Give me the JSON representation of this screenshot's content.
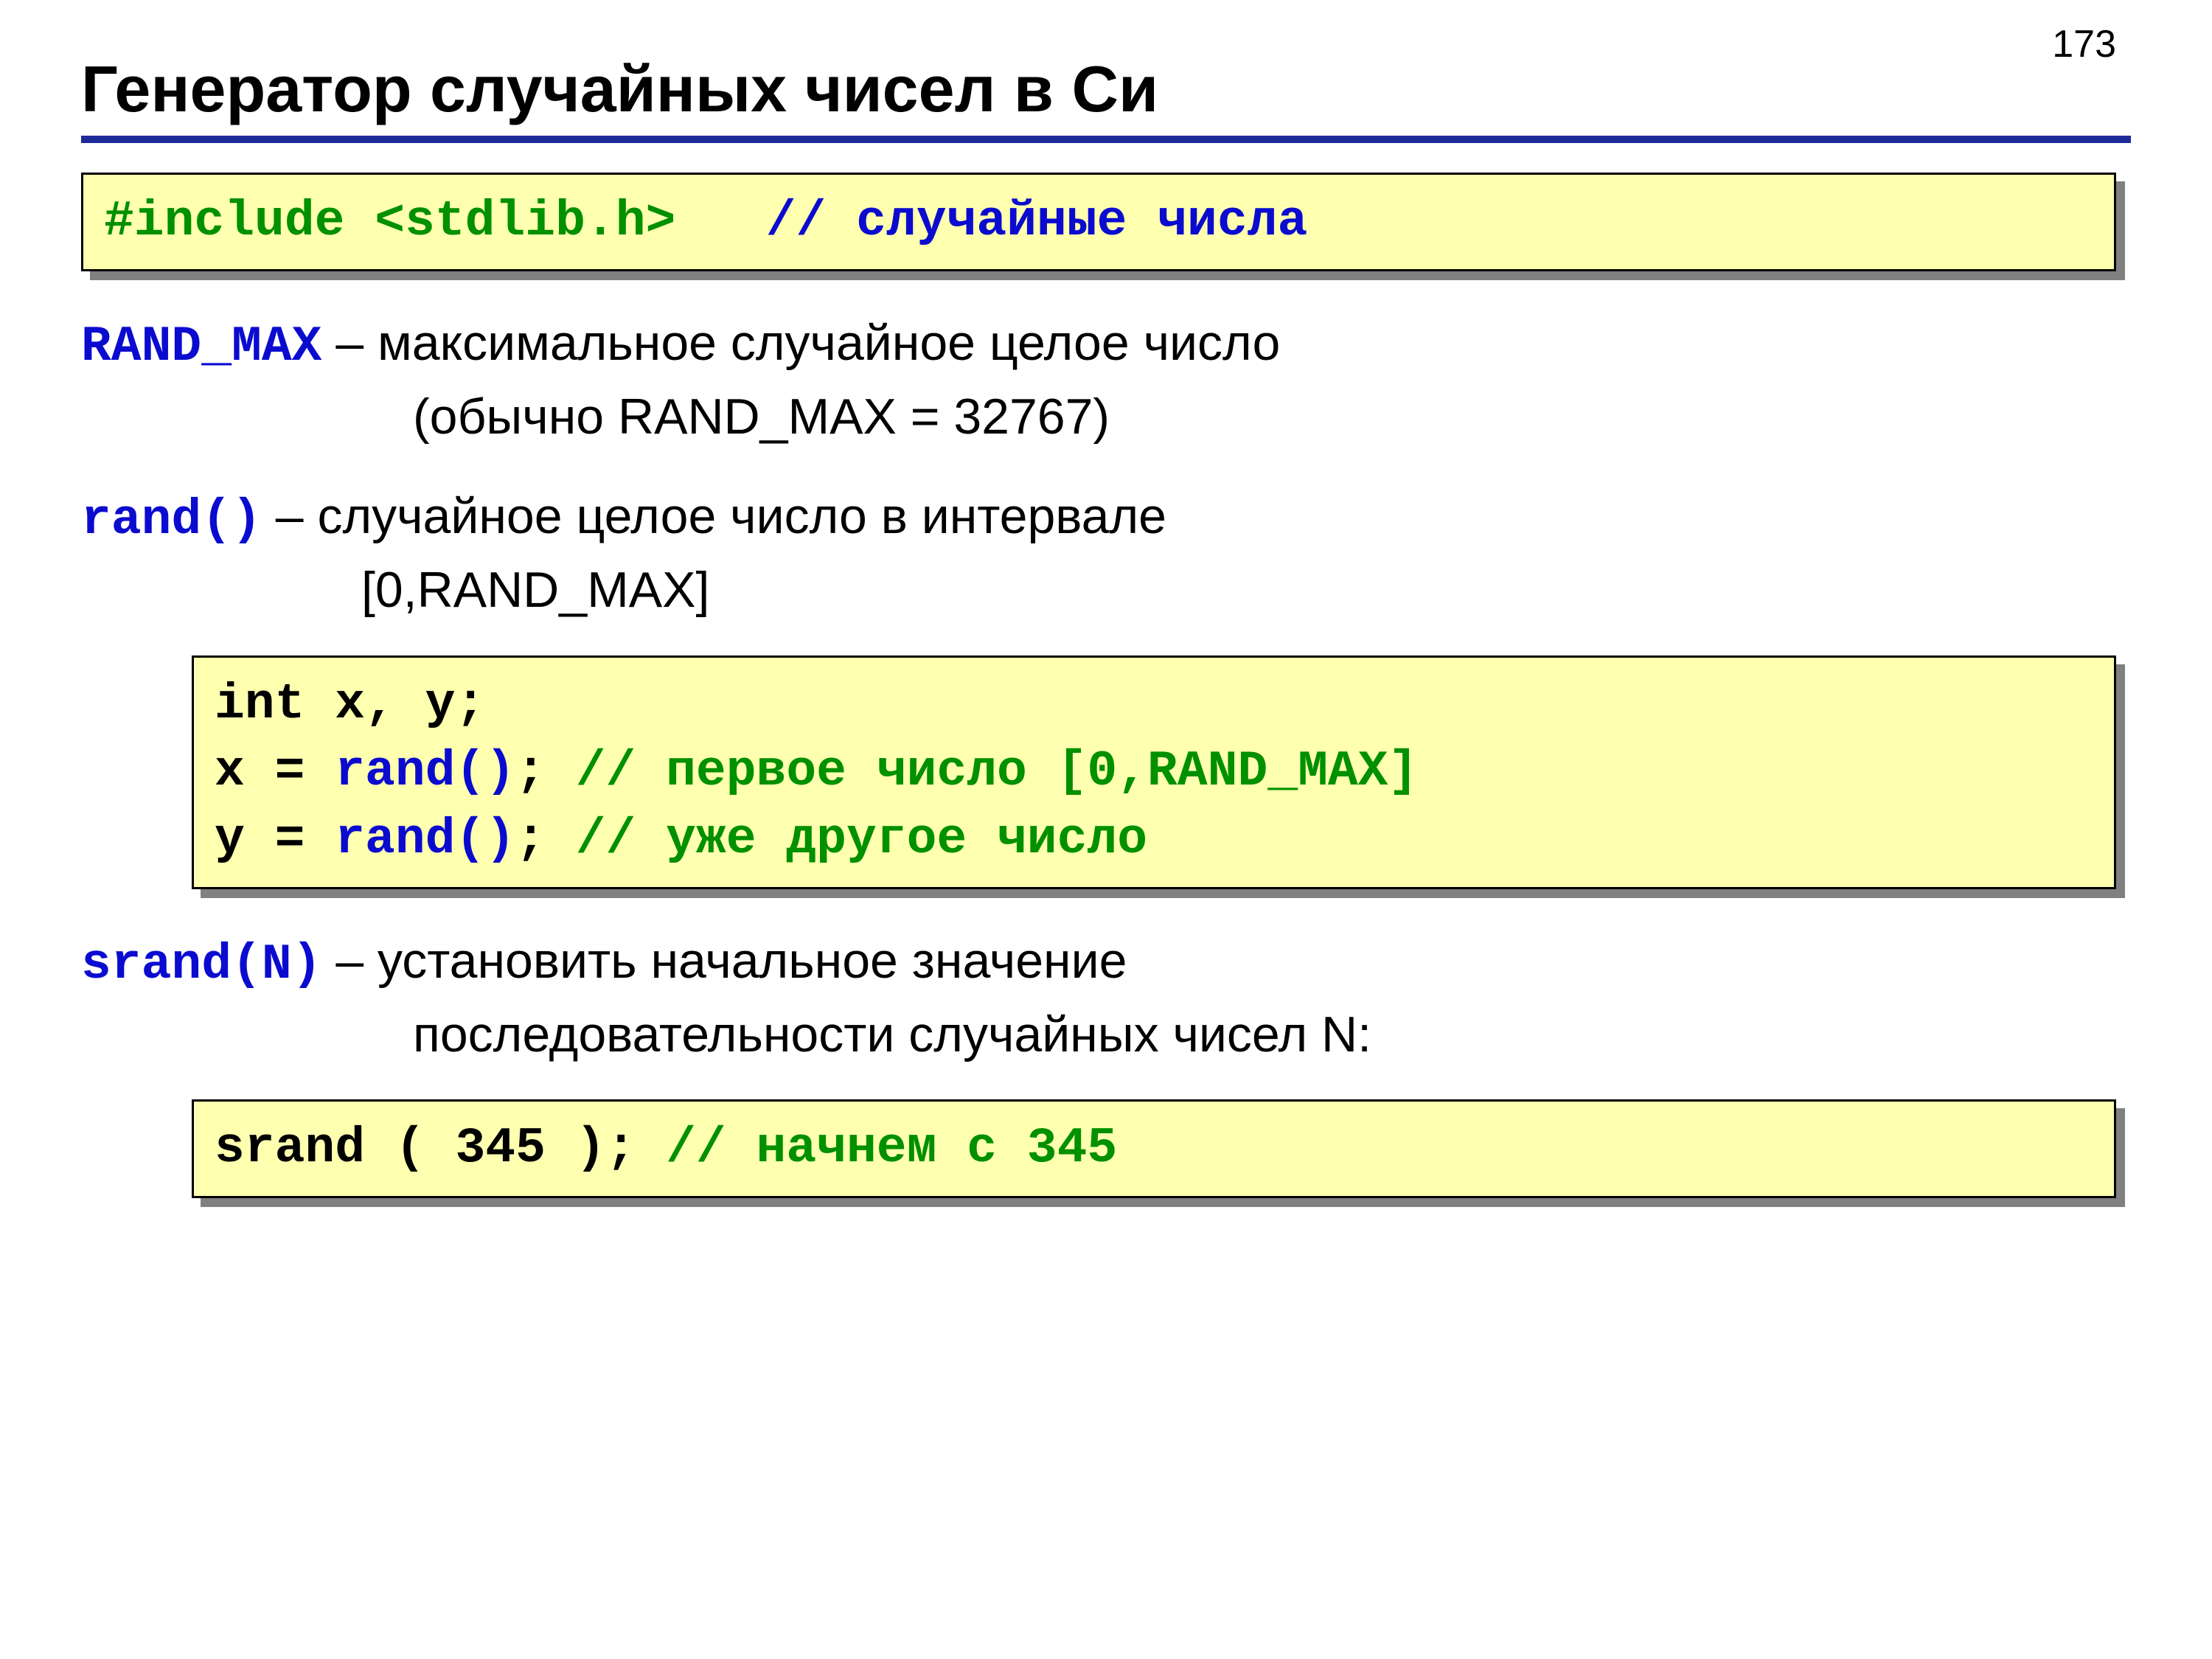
{
  "page_number": "173",
  "title": "Генератор случайных чисел в Си",
  "code1": {
    "include": "#include <stdlib.h>",
    "gap": "   ",
    "comment": "// случайные числа"
  },
  "randmax": {
    "label": "RAND_MAX",
    "desc1": " – максимальное случайное целое число",
    "desc2": "(обычно RAND_MAX = 32767)"
  },
  "randfn": {
    "label": "rand()",
    "desc1": "  – случайное целое число в интервале",
    "desc2": "[0,RAND_MAX]"
  },
  "code2": {
    "l1a": "int x, y;",
    "l2a": "x = ",
    "l2b": "rand()",
    "l2c": "; ",
    "l2d": "// первое число [0,RAND_MAX]",
    "l3a": "y = ",
    "l3b": "rand()",
    "l3c": "; ",
    "l3d": "// уже другое число"
  },
  "srand": {
    "label": "srand(N)",
    "desc1": " – установить начальное значение",
    "desc2": "последовательности случайных чисел N:"
  },
  "code3": {
    "a": "srand ( 345 );",
    "sp": " ",
    "b": "// начнем с 345"
  }
}
